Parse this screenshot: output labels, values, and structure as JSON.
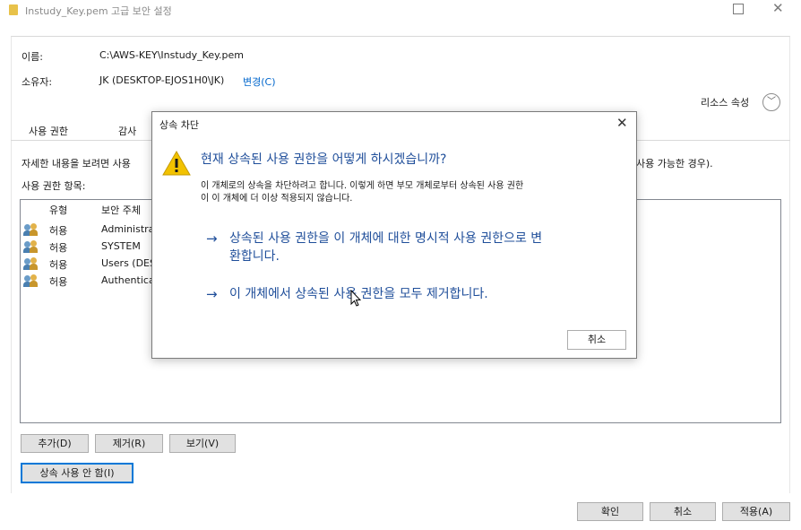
{
  "window": {
    "title": "Instudy_Key.pem 고급 보안 설정"
  },
  "info": {
    "name_label": "이름:",
    "name_value": "C:\\AWS-KEY\\Instudy_Key.pem",
    "owner_label": "소유자:",
    "owner_value": "JK (DESKTOP-EJOS1H0\\JK)",
    "owner_change_link": "변경(C)",
    "resource_props": "리소스 속성"
  },
  "tabs": [
    "사용 권한",
    "감사"
  ],
  "background": {
    "description_left": "자세한 내용을 보려면 사용",
    "description_right": "사용 가능한 경우).",
    "entries_label": "사용 권한 항목:",
    "columns": [
      "유형",
      "보안 주체"
    ],
    "rows": [
      {
        "type": "허용",
        "principal": "Administra"
      },
      {
        "type": "허용",
        "principal": "SYSTEM"
      },
      {
        "type": "허용",
        "principal": "Users (DES"
      },
      {
        "type": "허용",
        "principal": "Authentica"
      }
    ],
    "buttons": {
      "add": "추가(D)",
      "remove": "제거(R)",
      "view": "보기(V)",
      "disable_inheritance": "상속 사용 안 함(I)"
    },
    "footer": {
      "ok": "확인",
      "cancel": "취소",
      "apply": "적용(A)"
    }
  },
  "dialog": {
    "title": "상속 차단",
    "heading": "현재 상속된 사용 권한을 어떻게 하시겠습니까?",
    "description_line1": "이 개체로의 상속을 차단하려고 합니다. 이렇게 하면 부모 개체로부터 상속된 사용 권한",
    "description_line2": "이 이 개체에 더 이상 적용되지 않습니다.",
    "option1_line1": "상속된 사용 권한을 이 개체에 대한 명시적 사용 권한으로 변",
    "option1_line2": "환합니다.",
    "option2": "이 개체에서 상속된 사용 권한을 모두 제거합니다.",
    "arrow": "→",
    "cancel": "취소"
  },
  "colors": {
    "accent": "#0078d7",
    "link": "#0066cc",
    "dialog_text": "#1f4e9a",
    "warning": "#f2c200"
  }
}
